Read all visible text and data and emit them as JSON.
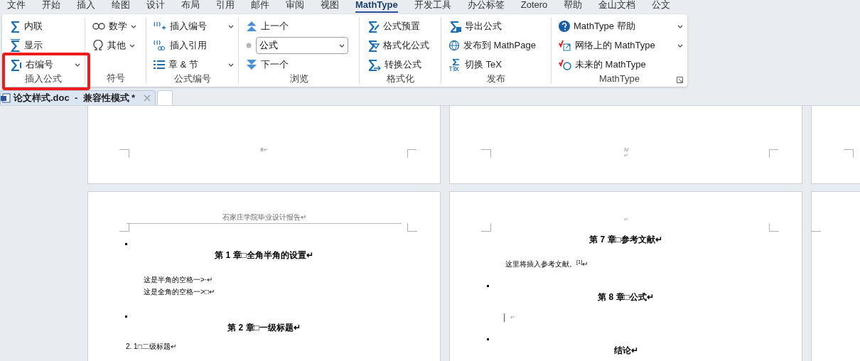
{
  "menu_tabs": [
    {
      "label": "文件",
      "selected": false
    },
    {
      "label": "开始",
      "selected": false
    },
    {
      "label": "插入",
      "selected": false
    },
    {
      "label": "绘图",
      "selected": false
    },
    {
      "label": "设计",
      "selected": false
    },
    {
      "label": "布局",
      "selected": false
    },
    {
      "label": "引用",
      "selected": false
    },
    {
      "label": "邮件",
      "selected": false
    },
    {
      "label": "审阅",
      "selected": false
    },
    {
      "label": "视图",
      "selected": false
    },
    {
      "label": "MathType",
      "selected": true
    },
    {
      "label": "开发工具",
      "selected": false
    },
    {
      "label": "办公标签",
      "selected": false
    },
    {
      "label": "Zotero",
      "selected": false
    },
    {
      "label": "帮助",
      "selected": false
    },
    {
      "label": "金山文档",
      "selected": false
    },
    {
      "label": "公文",
      "selected": false
    }
  ],
  "ribbon": {
    "groups": [
      {
        "label": "插入公式",
        "items": [
          {
            "kind": "button",
            "label": "内联",
            "dropdown": false
          },
          {
            "kind": "button",
            "label": "显示",
            "dropdown": false
          },
          {
            "kind": "button",
            "label": "右编号",
            "dropdown": true
          }
        ]
      },
      {
        "label": "符号",
        "items": [
          {
            "kind": "button",
            "label": "数学",
            "dropdown": true
          },
          {
            "kind": "button",
            "label": "其他",
            "dropdown": true
          }
        ]
      },
      {
        "label": "公式编号",
        "items": [
          {
            "kind": "button",
            "label": "插入编号",
            "dropdown": true
          },
          {
            "kind": "button",
            "label": "插入引用",
            "dropdown": false
          },
          {
            "kind": "button",
            "label": "章 & 节",
            "dropdown": true
          }
        ]
      },
      {
        "label": "浏览",
        "items": [
          {
            "kind": "button",
            "label": "上一个",
            "dropdown": false
          },
          {
            "kind": "select",
            "value": "公式"
          },
          {
            "kind": "button",
            "label": "下一个",
            "dropdown": false
          }
        ]
      },
      {
        "label": "格式化",
        "items": [
          {
            "kind": "button",
            "label": "公式预置",
            "dropdown": false
          },
          {
            "kind": "button",
            "label": "格式化公式",
            "dropdown": false
          },
          {
            "kind": "button",
            "label": "转换公式",
            "dropdown": false
          }
        ]
      },
      {
        "label": "发布",
        "items": [
          {
            "kind": "button",
            "label": "导出公式",
            "dropdown": false
          },
          {
            "kind": "button",
            "label": "发布到 MathPage",
            "dropdown": false
          },
          {
            "kind": "button",
            "label": "切换 TeX",
            "dropdown": false
          }
        ]
      },
      {
        "label": "MathType",
        "items": [
          {
            "kind": "button",
            "label": "MathType 帮助",
            "dropdown": true
          },
          {
            "kind": "button",
            "label": "网络上的 MathType",
            "dropdown": true
          },
          {
            "kind": "button",
            "label": "未来的 MathType",
            "dropdown": false
          }
        ]
      }
    ]
  },
  "doc_tabs": [
    {
      "label": "论文样式.doc  -  兼容性模式 *",
      "selected": true
    }
  ],
  "pages": [
    {
      "blocks": [
        {
          "kind": "footer",
          "text": "Ⅲ↵"
        }
      ]
    },
    {
      "blocks": [
        {
          "kind": "footer",
          "text": "Ⅳ"
        },
        {
          "kind": "footer",
          "text": "↵"
        }
      ]
    },
    {
      "blocks": [
        {
          "kind": "header",
          "text": "石家庄学院毕业设计报告↵"
        },
        {
          "kind": "heading",
          "text": "第 1 章□全角半角的设置↵",
          "bullet": true
        },
        {
          "kind": "paragraph",
          "text": "这是半角的空格一>·↵"
        },
        {
          "kind": "line",
          "text": "这是全角的空格一>□↵"
        },
        {
          "kind": "heading",
          "text": "第 2 章□一级标题↵",
          "bullet": true
        },
        {
          "kind": "subheading",
          "text": "2. 1□二级标题↵"
        }
      ]
    },
    {
      "blocks": [
        {
          "kind": "mark",
          "text": "↵"
        },
        {
          "kind": "heading",
          "text": "第 7 章□参考文献↵",
          "bullet": false
        },
        {
          "kind": "paragraph",
          "text": "这里将插入参考文献。$^{[1]}$↵"
        },
        {
          "kind": "heading",
          "text": "第 8 章□公式↵",
          "bullet": true
        },
        {
          "kind": "cursor",
          "text": "↵"
        },
        {
          "kind": "heading",
          "text": "结论↵",
          "bullet": true
        }
      ]
    }
  ]
}
